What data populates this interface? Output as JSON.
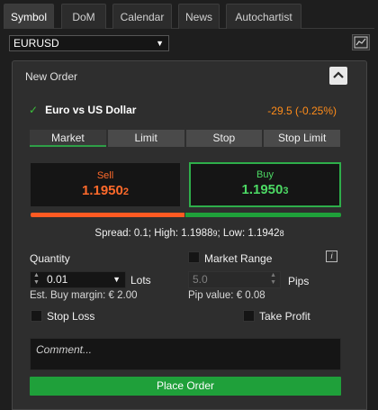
{
  "tabs": [
    {
      "label": "Symbol",
      "active": true
    },
    {
      "label": "DoM",
      "active": false
    },
    {
      "label": "Calendar",
      "active": false
    },
    {
      "label": "News",
      "active": false
    },
    {
      "label": "Autochartist",
      "active": false
    }
  ],
  "symbol_select": {
    "value": "EURUSD"
  },
  "panel": {
    "title": "New Order",
    "instrument": "Euro vs US Dollar",
    "change": "-29.5 (-0.25%)",
    "order_types": [
      "Market",
      "Limit",
      "Stop",
      "Stop Limit"
    ],
    "active_order_type": "Market",
    "sell": {
      "label": "Sell",
      "price_main": "1.1950",
      "price_small": "2"
    },
    "buy": {
      "label": "Buy",
      "price_main": "1.1950",
      "price_small": "3"
    },
    "spread_text": "Spread: 0.1; High: 1.1988",
    "spread_high_small": "9",
    "spread_low_text": "; Low: 1.1942",
    "spread_low_small": "8",
    "quantity_label": "Quantity",
    "quantity_value": "0.01",
    "lots_label": "Lots",
    "market_range_label": "Market Range",
    "info_label": "i",
    "pips_value": "5.0",
    "pips_label": "Pips",
    "margin_text": "Est. Buy margin: € 2.00",
    "pip_value_text": "Pip value: € 0.08",
    "stop_loss_label": "Stop Loss",
    "take_profit_label": "Take Profit",
    "comment_placeholder": "Comment...",
    "place_order_label": "Place Order"
  },
  "colors": {
    "sell": "#ff6a2b",
    "buy": "#4cd964",
    "accent_green": "#1fa03a",
    "change": "#ff8c1a"
  }
}
